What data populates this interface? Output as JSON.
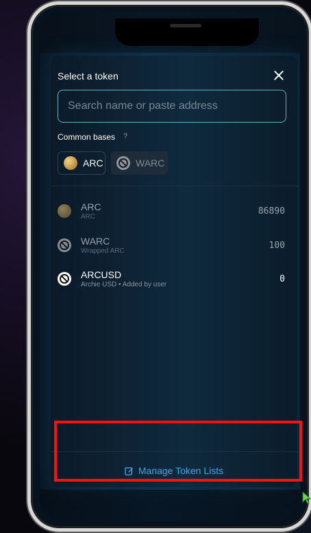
{
  "modal": {
    "title": "Select a token",
    "search_placeholder": "Search name or paste address",
    "common_bases_label": "Common bases",
    "help_glyph": "?",
    "common_bases": [
      {
        "symbol": "ARC",
        "icon": "arc-coin-icon"
      },
      {
        "symbol": "WARC",
        "icon": "ban-icon"
      }
    ],
    "tokens": [
      {
        "symbol": "ARC",
        "name": "ARC",
        "balance": "86890",
        "icon": "arc-coin-icon"
      },
      {
        "symbol": "WARC",
        "name": "Wrapped ARC",
        "balance": "100",
        "icon": "ban-icon"
      },
      {
        "symbol": "ARCUSD",
        "name": "Archie USD • Added by user",
        "balance": "0",
        "icon": "ban-icon"
      }
    ],
    "manage_label": "Manage Token Lists"
  },
  "colors": {
    "accent": "#3da7e8",
    "input_border": "#5eb3c4",
    "highlight": "#ff1010"
  }
}
